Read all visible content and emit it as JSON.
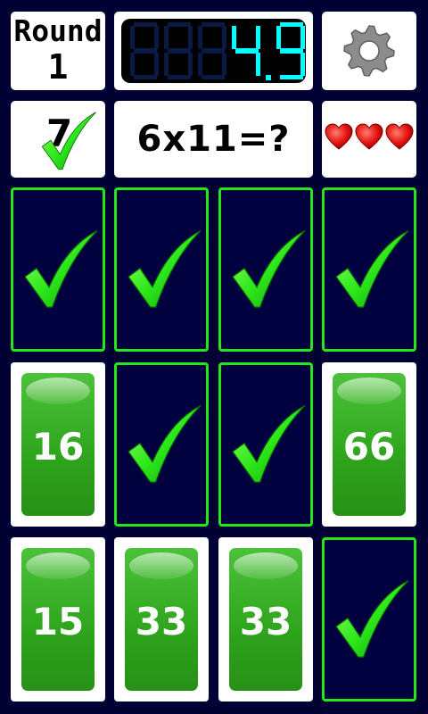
{
  "header": {
    "round_label": "Round",
    "round_number": "1",
    "timer_value": "4.96",
    "timer_ghost_digits": "888",
    "settings_icon": "gear-icon"
  },
  "status": {
    "score": "7",
    "score_icon": "checkmark-icon",
    "question": "6x11=?",
    "lives": 3,
    "life_icon": "heart-icon"
  },
  "colors": {
    "background": "#010133",
    "lcd_digits": "#00ffff",
    "card_border": "#25e61b",
    "card_face": "#2ea31c"
  },
  "cards": [
    {
      "state": "matched",
      "value": ""
    },
    {
      "state": "matched",
      "value": ""
    },
    {
      "state": "matched",
      "value": ""
    },
    {
      "state": "matched",
      "value": ""
    },
    {
      "state": "revealed",
      "value": "16"
    },
    {
      "state": "matched",
      "value": ""
    },
    {
      "state": "matched",
      "value": ""
    },
    {
      "state": "revealed",
      "value": "66"
    },
    {
      "state": "revealed",
      "value": "15"
    },
    {
      "state": "revealed",
      "value": "33"
    },
    {
      "state": "revealed",
      "value": "33"
    },
    {
      "state": "matched",
      "value": ""
    }
  ]
}
